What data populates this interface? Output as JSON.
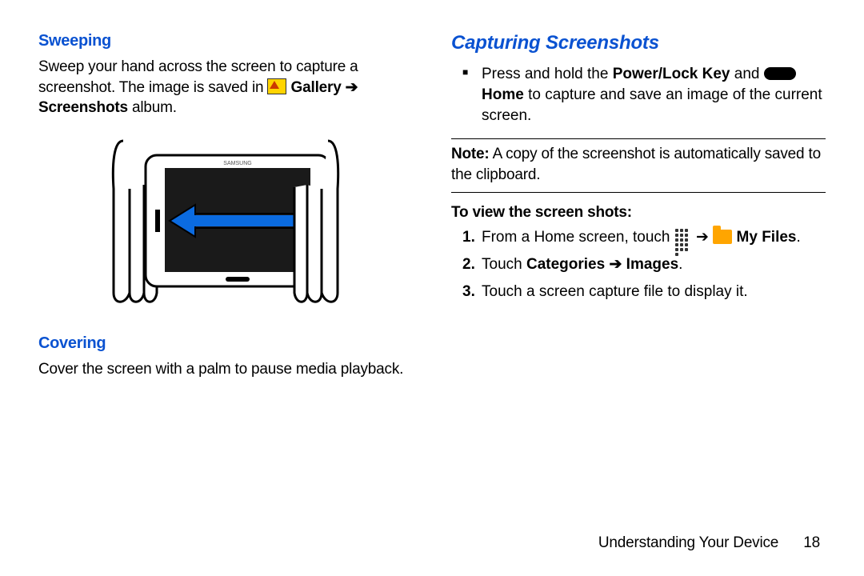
{
  "left": {
    "sweeping": {
      "heading": "Sweeping",
      "p1a": "Sweep your hand across the screen to capture a screenshot. The image is saved in ",
      "gallery_label": " Gallery ➔ Screenshots",
      "p1b": " album."
    },
    "covering": {
      "heading": "Covering",
      "p": "Cover the screen with a palm to pause media playback."
    }
  },
  "right": {
    "heading": "Capturing Screenshots",
    "bullet_a": "Press and hold the ",
    "bullet_key1": "Power/Lock Key",
    "bullet_mid": " and ",
    "bullet_key2": " Home",
    "bullet_b": " to capture and save an image of the current screen.",
    "note_label": "Note:",
    "note_text": " A copy of the screenshot is automatically saved to the clipboard.",
    "subhead": "To view the screen shots:",
    "step1a": "From a Home screen, touch ",
    "step1_arrow": " ➔ ",
    "step1b": " My Files",
    "step1c": ".",
    "step2a": "Touch ",
    "step2b": "Categories ➔ Images",
    "step2c": ".",
    "step3": "Touch a screen capture file to display it."
  },
  "footer": {
    "section": "Understanding Your Device",
    "page": "18"
  }
}
